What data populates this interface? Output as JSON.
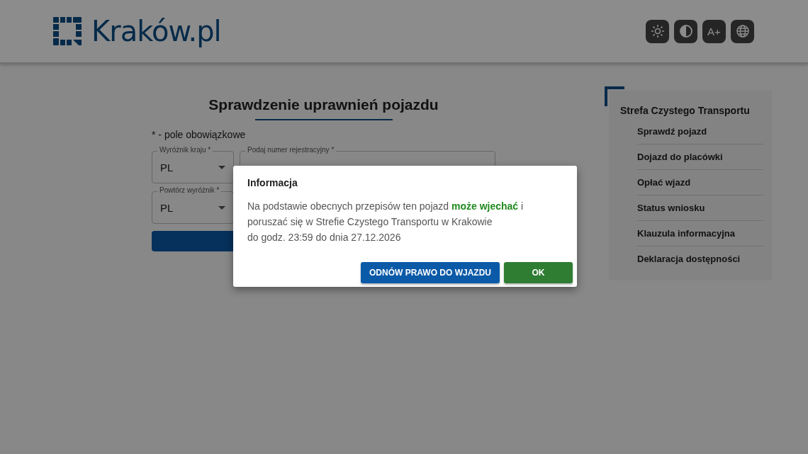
{
  "header": {
    "logo_text": "Kraków.pl",
    "tools": [
      {
        "kind": "brightness"
      },
      {
        "kind": "contrast"
      },
      {
        "kind": "font",
        "label": "A+"
      },
      {
        "kind": "language"
      }
    ]
  },
  "form": {
    "title": "Sprawdzenie uprawnień pojazdu",
    "required_note": "* - pole obowiązkowe",
    "country": {
      "label": "Wyróżnik kraju *",
      "value": "PL"
    },
    "plate": {
      "label": "Podaj numer rejestracyjny *"
    },
    "repeat_country": {
      "label": "Powtórz wyróżnik *",
      "value": "PL"
    }
  },
  "sidebar": {
    "title": "Strefa Czystego Transportu",
    "items": [
      "Sprawdź pojazd",
      "Dojazd do placówki",
      "Opłać wjazd",
      "Status wniosku",
      "Klauzula informacyjna",
      "Deklaracja dostępności"
    ]
  },
  "dialog": {
    "title": "Informacja",
    "message": "Na podstawie obecnych przepisów ten pojazd **może wjechać** i\nporuszać się w Strefie Czystego Transportu w Krakowie\ndo godz. 23:59 do dnia 27.12.2026",
    "buttons": [
      {
        "kind": "secondary",
        "label": "ODNÓW PRAWO DO WJAZDU"
      },
      {
        "kind": "primary",
        "label": "OK"
      }
    ]
  }
}
